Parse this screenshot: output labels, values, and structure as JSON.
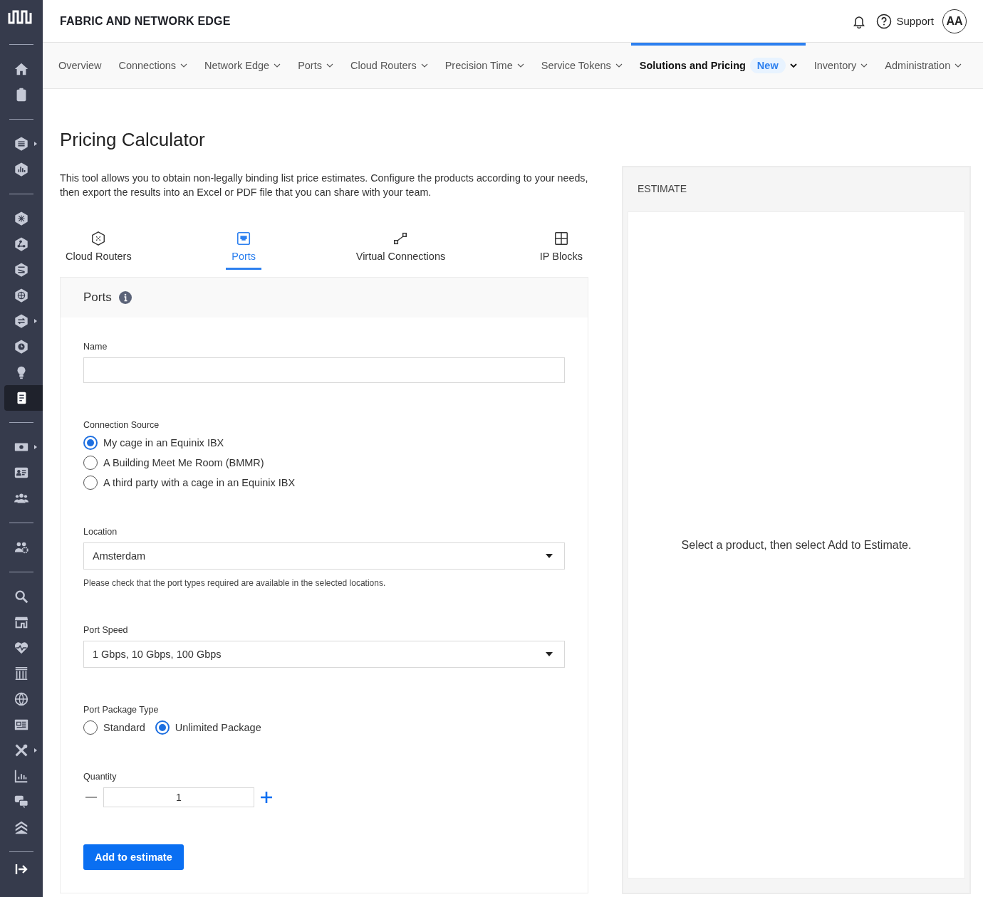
{
  "header": {
    "title": "FABRIC AND NETWORK EDGE",
    "support": "Support",
    "avatar": "AA"
  },
  "sidebar": {
    "groups": [
      [
        {
          "selected": false,
          "submenu": false
        },
        {
          "selected": false,
          "submenu": false
        }
      ],
      [
        {
          "selected": false,
          "submenu": true
        },
        {
          "selected": false,
          "submenu": false
        }
      ],
      [
        {
          "selected": false,
          "submenu": false
        },
        {
          "selected": false,
          "submenu": false
        },
        {
          "selected": false,
          "submenu": false
        },
        {
          "selected": false,
          "submenu": false
        },
        {
          "selected": false,
          "submenu": true
        },
        {
          "selected": false,
          "submenu": false
        },
        {
          "selected": false,
          "submenu": false
        },
        {
          "selected": true,
          "submenu": false
        }
      ],
      [
        {
          "selected": false,
          "submenu": true
        },
        {
          "selected": false,
          "submenu": false
        },
        {
          "selected": false,
          "submenu": false
        }
      ],
      [
        {
          "selected": false,
          "submenu": false
        }
      ],
      [
        {
          "selected": false,
          "submenu": false
        },
        {
          "selected": false,
          "submenu": false
        },
        {
          "selected": false,
          "submenu": false
        },
        {
          "selected": false,
          "submenu": false
        },
        {
          "selected": false,
          "submenu": false
        },
        {
          "selected": false,
          "submenu": false
        },
        {
          "selected": false,
          "submenu": true
        },
        {
          "selected": false,
          "submenu": false
        },
        {
          "selected": false,
          "submenu": false
        },
        {
          "selected": false,
          "submenu": false
        }
      ]
    ]
  },
  "nav": [
    {
      "label": "Overview",
      "dropdown": false,
      "selected": false
    },
    {
      "label": "Connections",
      "dropdown": true,
      "selected": false
    },
    {
      "label": "Network Edge",
      "dropdown": true,
      "selected": false
    },
    {
      "label": "Ports",
      "dropdown": true,
      "selected": false
    },
    {
      "label": "Cloud Routers",
      "dropdown": true,
      "selected": false
    },
    {
      "label": "Precision Time",
      "dropdown": true,
      "selected": false
    },
    {
      "label": "Service Tokens",
      "dropdown": true,
      "selected": false
    },
    {
      "label": "Solutions and Pricing",
      "badge": "New",
      "dropdown": true,
      "selected": true
    },
    {
      "label": "Inventory",
      "dropdown": true,
      "selected": false
    },
    {
      "label": "Administration",
      "dropdown": true,
      "selected": false
    }
  ],
  "page": {
    "title": "Pricing Calculator",
    "description": "This tool allows you to obtain non-legally binding list price estimates. Configure the products according to your needs, then export the results into an Excel or PDF file that you can share with your team."
  },
  "product_tabs": [
    {
      "label": "Cloud Routers",
      "selected": false
    },
    {
      "label": "Ports",
      "selected": true
    },
    {
      "label": "Virtual Connections",
      "selected": false
    },
    {
      "label": "IP Blocks",
      "selected": false
    }
  ],
  "form": {
    "title": "Ports",
    "fields": [
      {
        "kind": "text",
        "label": "Name"
      },
      {
        "kind": "radio_list",
        "label": "Connection Source",
        "options": [
          {
            "label": "My cage in an Equinix IBX",
            "selected": true
          },
          {
            "label": "A Building Meet Me Room (BMMR)",
            "selected": false
          },
          {
            "label": "A third party with a cage in an Equinix IBX",
            "selected": false
          }
        ]
      },
      {
        "kind": "select",
        "label": "Location",
        "value": "Amsterdam",
        "hint": "Please check that the port types required are available in the selected locations."
      },
      {
        "kind": "select",
        "label": "Port Speed",
        "value": "1 Gbps, 10 Gbps, 100 Gbps"
      },
      {
        "kind": "radio_row",
        "label": "Port Package Type",
        "options": [
          {
            "label": "Standard",
            "selected": false
          },
          {
            "label": "Unlimited Package",
            "selected": true
          }
        ]
      },
      {
        "kind": "quantity",
        "label": "Quantity",
        "value": "1"
      }
    ],
    "submit": "Add to estimate"
  },
  "estimate": {
    "title": "ESTIMATE",
    "empty_message": "Select a product, then select Add to Estimate."
  }
}
